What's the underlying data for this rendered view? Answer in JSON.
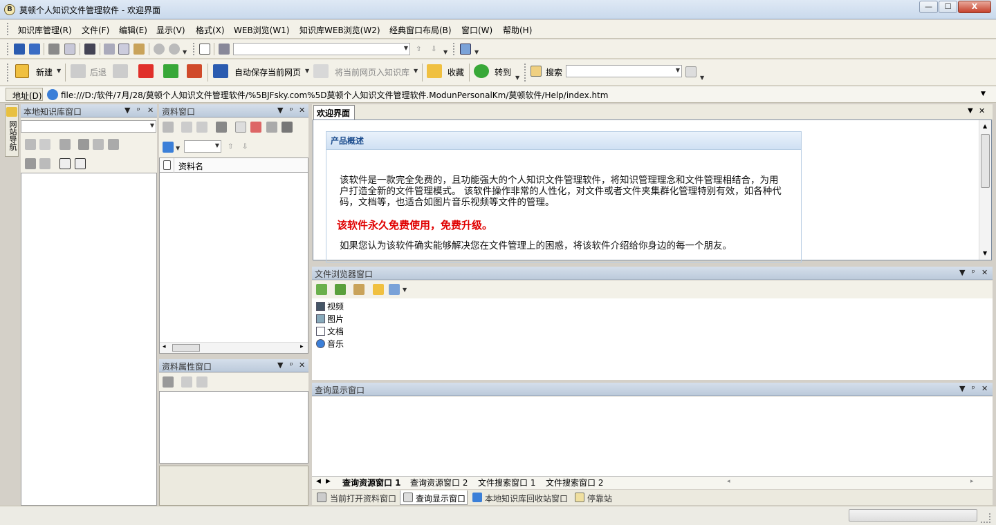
{
  "window": {
    "title": "莫顿个人知识文件管理软件 - 欢迎界面",
    "app_icon": "B",
    "minimize": "—",
    "maximize": "☐",
    "close": "X"
  },
  "menu": [
    "知识库管理(R)",
    "文件(F)",
    "编辑(E)",
    "显示(V)",
    "格式(X)",
    "WEB浏览(W1)",
    "知识库WEB浏览(W2)",
    "经典窗口布局(B)",
    "窗口(W)",
    "帮助(H)"
  ],
  "toolbar2": {
    "new_label": "新建",
    "back_label": "后退",
    "autosave_label": "自动保存当前网页",
    "import_label": "将当前网页入知识库",
    "favorite_label": "收藏",
    "goto_label": "转到",
    "search_label": "搜索"
  },
  "address": {
    "label": "地址(D)",
    "url": "file:///D:/软件/7月/28/莫顿个人知识文件管理软件/%5BJFsky.com%5D莫顿个人知识文件管理软件.ModunPersonalKm/莫顿软件/Help/index.htm"
  },
  "side_tab": "网站导航",
  "panes": {
    "local_kb": "本地知识库窗口",
    "resource": "资料窗口",
    "resource_col": "资料名",
    "resource_props": "资料属性窗口",
    "file_browser": "文件浏览器窗口",
    "query_display": "查询显示窗口"
  },
  "welcome": {
    "tab": "欢迎界面",
    "section_title": "产品概述",
    "p1": "该软件是一款完全免费的，且功能强大的个人知识文件管理软件，将知识管理理念和文件管理相结合，为用户打造全新的文件管理模式。 该软件操作非常的人性化，对文件或者文件夹集群化管理特别有效，如各种代码，文档等，也适合如图片音乐视频等文件的管理。",
    "p2": "该软件永久免费使用，免费升级。",
    "p3": "如果您认为该软件确实能够解决您在文件管理上的困惑，将该软件介绍给你身边的每一个朋友。"
  },
  "file_tree": [
    "视频",
    "图片",
    "文档",
    "音乐"
  ],
  "bottom_tabs": [
    "查询资源窗口 1",
    "查询资源窗口 2",
    "文件搜索窗口 1",
    "文件搜索窗口 2"
  ],
  "dock_tabs": [
    "当前打开资料窗口",
    "查询显示窗口",
    "本地知识库回收站窗口",
    "停靠站"
  ],
  "colors": {
    "accent_red": "#e00000",
    "heading_blue": "#1f4f8f"
  }
}
